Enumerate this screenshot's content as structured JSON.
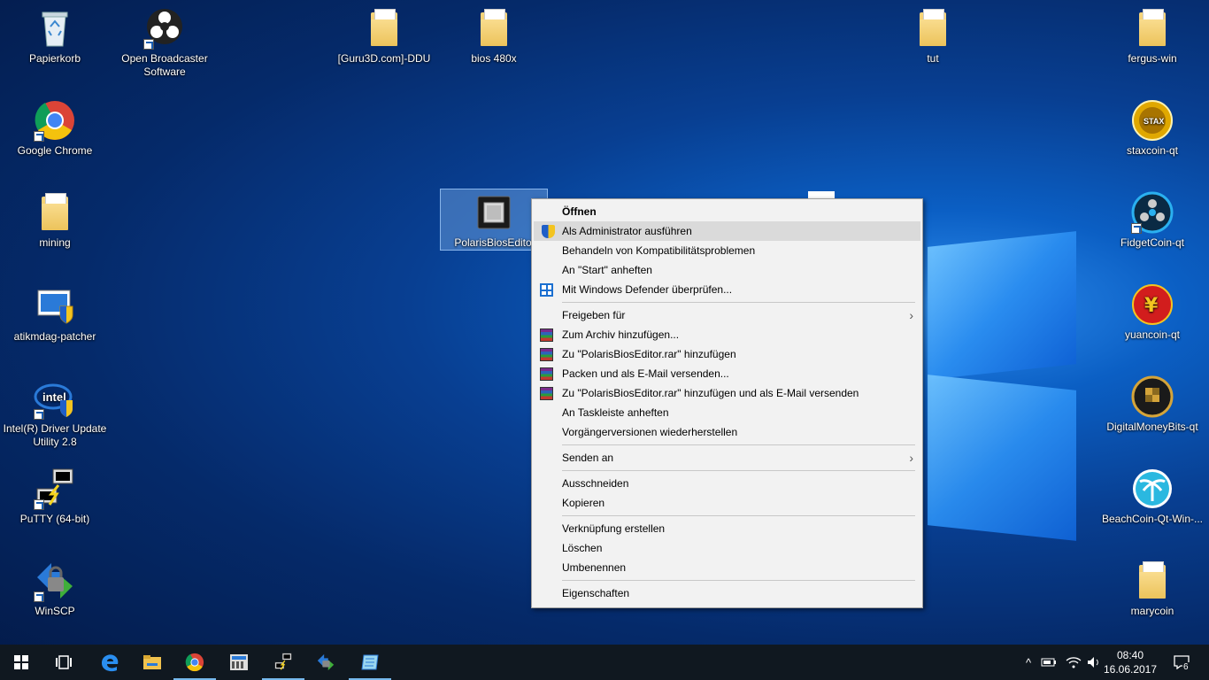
{
  "desktop_icons": [
    {
      "label": "Papierkorb",
      "icon": "recycle-bin-icon"
    },
    {
      "label": "Open Broadcaster Software",
      "icon": "obs-icon"
    },
    {
      "label": "[Guru3D.com]-DDU",
      "icon": "folder-icon"
    },
    {
      "label": "bios 480x",
      "icon": "folder-icon"
    },
    {
      "label": "tut",
      "icon": "folder-icon"
    },
    {
      "label": "fergus-win",
      "icon": "folder-icon"
    },
    {
      "label": "Google Chrome",
      "icon": "chrome-icon"
    },
    {
      "label": "staxcoin-qt",
      "icon": "staxcoin-icon"
    },
    {
      "label": "mining",
      "icon": "folder-icon"
    },
    {
      "label": "PolarisBiosEditor",
      "icon": "chip-icon"
    },
    {
      "label": "FidgetCoin-qt",
      "icon": "fidgetcoin-icon"
    },
    {
      "label": "atikmdag-patcher",
      "icon": "patcher-icon"
    },
    {
      "label": "yuancoin-qt",
      "icon": "yuancoin-icon"
    },
    {
      "label": "Intel(R) Driver Update Utility 2.8",
      "icon": "intel-icon"
    },
    {
      "label": "DigitalMoneyBits-qt",
      "icon": "digitalmoneybits-icon"
    },
    {
      "label": "PuTTY (64-bit)",
      "icon": "putty-icon"
    },
    {
      "label": "BeachCoin-Qt-Win-...",
      "icon": "beachcoin-icon"
    },
    {
      "label": "WinSCP",
      "icon": "winscp-icon"
    },
    {
      "label": "marycoin",
      "icon": "folder-icon"
    }
  ],
  "context_menu": {
    "items": [
      {
        "label": "Öffnen"
      },
      {
        "label": "Als Administrator ausführen"
      },
      {
        "label": "Behandeln von Kompatibilitätsproblemen"
      },
      {
        "label": "An \"Start\" anheften"
      },
      {
        "label": "Mit Windows Defender überprüfen..."
      },
      {
        "label": "Freigeben für"
      },
      {
        "label": "Zum Archiv hinzufügen..."
      },
      {
        "label": "Zu \"PolarisBiosEditor.rar\" hinzufügen"
      },
      {
        "label": "Packen und als E-Mail versenden..."
      },
      {
        "label": "Zu \"PolarisBiosEditor.rar\" hinzufügen und als E-Mail versenden"
      },
      {
        "label": "An Taskleiste anheften"
      },
      {
        "label": "Vorgängerversionen wiederherstellen"
      },
      {
        "label": "Senden an"
      },
      {
        "label": "Ausschneiden"
      },
      {
        "label": "Kopieren"
      },
      {
        "label": "Verknüpfung erstellen"
      },
      {
        "label": "Löschen"
      },
      {
        "label": "Umbenennen"
      },
      {
        "label": "Eigenschaften"
      }
    ],
    "submenu_arrow": "›"
  },
  "taskbar": {
    "start_icon": "windows-start-icon",
    "apps": [
      "task-view-icon",
      "edge-icon",
      "file-explorer-icon",
      "chrome-icon",
      "calculator-icon",
      "putty-icon",
      "winscp-icon",
      "notepad-icon"
    ],
    "tray_chevron": "^",
    "clock_time": "08:40",
    "clock_date": "16.06.2017",
    "notification_count": "6"
  },
  "colors": {
    "taskbar": "#101820",
    "menu_bg": "#f2f2f2",
    "menu_highlight": "#dadada",
    "selection": "#76b9ed"
  }
}
